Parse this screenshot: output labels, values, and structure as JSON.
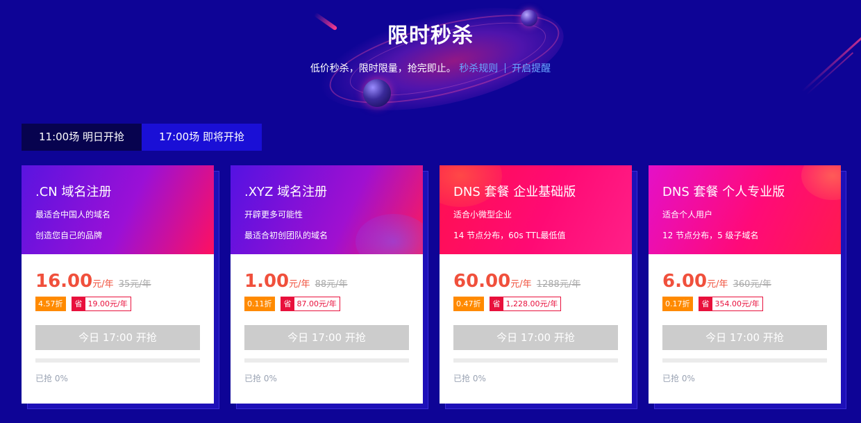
{
  "header": {
    "title": "限时秒杀",
    "subtitle": "低价秒杀，限时限量，抢完即止。",
    "rules_link": "秒杀规则",
    "remind_link": "开启提醒"
  },
  "tabs": [
    {
      "label": "11:00场 明日开抢",
      "active": true
    },
    {
      "label": "17:00场 即将开抢",
      "active": false
    }
  ],
  "cards": [
    {
      "title": ".CN 域名注册",
      "line1": "最适合中国人的域名",
      "line2": "创造您自己的品牌",
      "price": "16.00",
      "unit": "元/年",
      "original": "35元/年",
      "discount": "4.57折",
      "save_tag": "省",
      "save_amount": "19.00元/年",
      "button": "今日 17:00 开抢",
      "progress": 0,
      "sold": "已抢 0%"
    },
    {
      "title": ".XYZ 域名注册",
      "line1": "开辟更多可能性",
      "line2": "最适合初创团队的域名",
      "price": "1.00",
      "unit": "元/年",
      "original": "88元/年",
      "discount": "0.11折",
      "save_tag": "省",
      "save_amount": "87.00元/年",
      "button": "今日 17:00 开抢",
      "progress": 0,
      "sold": "已抢 0%"
    },
    {
      "title": "DNS 套餐 企业基础版",
      "line1": "适合小微型企业",
      "line2": "14 节点分布，60s TTL最低值",
      "price": "60.00",
      "unit": "元/年",
      "original": "1288元/年",
      "discount": "0.47折",
      "save_tag": "省",
      "save_amount": "1,228.00元/年",
      "button": "今日 17:00 开抢",
      "progress": 0,
      "sold": "已抢 0%"
    },
    {
      "title": "DNS 套餐 个人专业版",
      "line1": "适合个人用户",
      "line2": "12 节点分布，5 级子域名",
      "price": "6.00",
      "unit": "元/年",
      "original": "360元/年",
      "discount": "0.17折",
      "save_tag": "省",
      "save_amount": "354.00元/年",
      "button": "今日 17:00 开抢",
      "progress": 0,
      "sold": "已抢 0%"
    }
  ],
  "colors": {
    "background": "#0e0496",
    "price": "#f0503c",
    "discount_badge": "#ff8a00",
    "save_badge": "#e8103c",
    "link": "#6aa6ff",
    "button_disabled": "#cccccc"
  }
}
